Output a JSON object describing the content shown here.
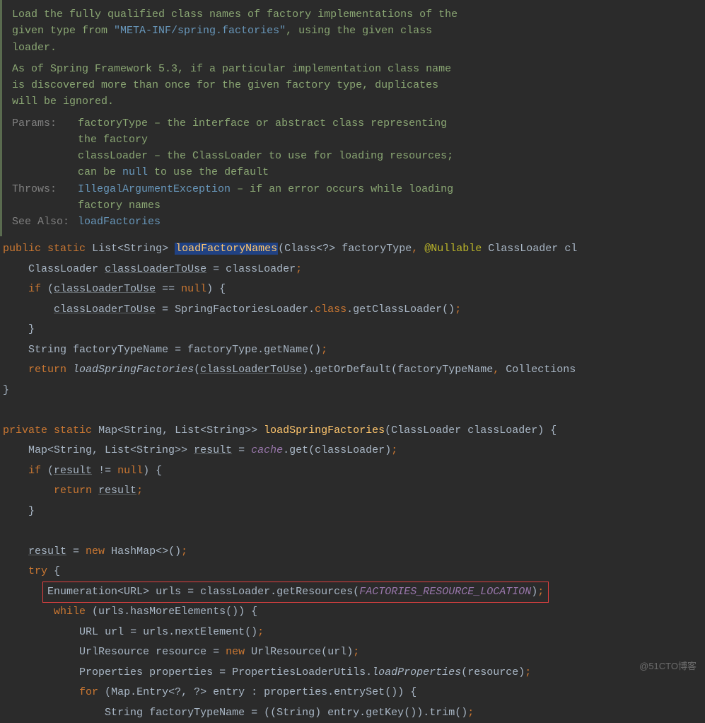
{
  "javadoc": {
    "desc1_a": "Load the fully qualified class names of factory implementations of the given type from ",
    "desc1_literal": "\"META-INF/spring.factories\"",
    "desc1_b": ", using the given class loader.",
    "desc2": "As of Spring Framework 5.3, if a particular implementation class name is discovered more than once for the given factory type, duplicates will be ignored.",
    "params_label": "Params:",
    "param1": "factoryType – the interface or abstract class representing the factory",
    "param2_a": "classLoader – the ClassLoader to use for loading resources; can be ",
    "param2_code": "null",
    "param2_b": " to use the default",
    "throws_label": "Throws:",
    "throws_link": "IllegalArgumentException",
    "throws_tail": " – if an error occurs while loading factory names",
    "seealso_label": "See Also:",
    "seealso_link": "loadFactories"
  },
  "code": {
    "kw_public": "public",
    "kw_static": "static",
    "kw_private": "private",
    "kw_if": "if",
    "kw_return": "return",
    "kw_new": "new",
    "kw_try": "try",
    "kw_while": "while",
    "kw_for": "for",
    "kw_null": "null",
    "kw_class": "class",
    "t_list_string": "List<String>",
    "t_map_sl": "Map<String, List<String>>",
    "t_class_q": "Class<?>",
    "t_classloader": "ClassLoader",
    "t_string": "String",
    "t_enum_url": "Enumeration<URL>",
    "t_url": "URL",
    "t_urlresource": "UrlResource",
    "t_properties": "Properties",
    "t_mapentry": "Map.Entry<?, ?>",
    "t_hashmap": "HashMap<>",
    "t_collections": "Collections",
    "m_loadFactoryNames": "loadFactoryNames",
    "m_loadSpringFactories": "loadSpringFactories",
    "m_getClassLoader": "getClassLoader",
    "m_getName": "getName",
    "m_getOrDefault": "getOrDefault",
    "m_get": "get",
    "m_getResources": "getResources",
    "m_hasMoreElements": "hasMoreElements",
    "m_nextElement": "nextElement",
    "m_loadProperties": "loadProperties",
    "m_entrySet": "entrySet",
    "m_getKey": "getKey",
    "m_trim": "trim",
    "p_factoryType": "factoryType",
    "p_classLoader": "classLoader",
    "v_classLoaderToUse": "classLoaderToUse",
    "v_factoryTypeName": "factoryTypeName",
    "v_result": "result",
    "v_urls": "urls",
    "v_url": "url",
    "v_resource": "resource",
    "v_properties": "properties",
    "v_entry": "entry",
    "c_SpringFactoriesLoader": "SpringFactoriesLoader",
    "c_PropertiesLoaderUtils": "PropertiesLoaderUtils",
    "a_nullable": "@Nullable",
    "f_cache": "cache",
    "const_frl": "FACTORIES_RESOURCE_LOCATION",
    "tail_cl": "cl"
  },
  "watermark": "@51CTO博客"
}
